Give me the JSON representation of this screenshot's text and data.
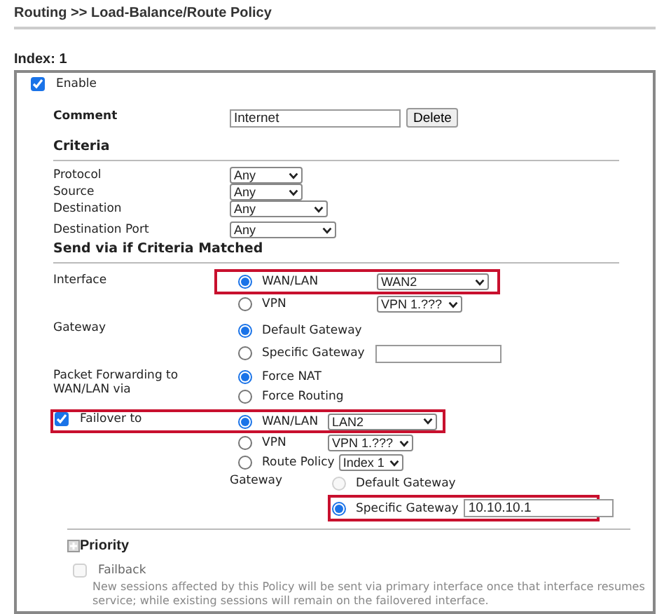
{
  "breadcrumb": "Routing >> Load-Balance/Route Policy",
  "index_label": "Index: 1",
  "enable": {
    "label": "Enable",
    "checked": true
  },
  "comment": {
    "label": "Comment",
    "value": "Internet",
    "button": "Delete"
  },
  "criteria": {
    "title": "Criteria",
    "rows": [
      {
        "label": "Protocol",
        "value": "Any"
      },
      {
        "label": "Source",
        "value": "Any"
      },
      {
        "label": "Destination",
        "value": "Any"
      },
      {
        "label": "Destination Port",
        "value": "Any"
      }
    ]
  },
  "send_via": {
    "title": "Send via if Criteria Matched",
    "interface": {
      "label": "Interface",
      "options": [
        {
          "label": "WAN/LAN",
          "selected": true,
          "select": "WAN2",
          "highlighted": true
        },
        {
          "label": "VPN",
          "selected": false,
          "select": "VPN 1.???",
          "highlighted": false
        }
      ]
    },
    "gateway": {
      "label": "Gateway",
      "options": [
        {
          "label": "Default Gateway",
          "selected": true,
          "kind": "plain"
        },
        {
          "label": "Specific Gateway",
          "selected": false,
          "kind": "input"
        }
      ]
    },
    "packet_forwarding": {
      "label": "Packet Forwarding to WAN/LAN via",
      "options": [
        {
          "label": "Force NAT",
          "selected": true
        },
        {
          "label": "Force Routing",
          "selected": false
        }
      ]
    },
    "failover": {
      "label": "Failover to",
      "checked": true,
      "highlighted": true,
      "options": [
        {
          "label": "WAN/LAN",
          "selected": true,
          "select": "LAN2"
        },
        {
          "label": "VPN",
          "selected": false,
          "select": "VPN 1.???"
        },
        {
          "label": "Route Policy",
          "selected": false,
          "select": "Index 1"
        }
      ],
      "gateway": {
        "label": "Gateway",
        "options": [
          {
            "label": "Default Gateway",
            "selected": false,
            "disabled": true,
            "highlighted": false
          },
          {
            "label": "Specific Gateway",
            "selected": true,
            "disabled": false,
            "value": "10.10.10.1",
            "highlighted": true
          }
        ]
      }
    }
  },
  "priority": {
    "title": "Priority",
    "failback": {
      "label": "Failback",
      "checked": false,
      "disabled": true
    },
    "note": "New sessions affected by this Policy will be sent via primary interface once that interface resumes service; while existing sessions will remain on the failovered interface."
  }
}
